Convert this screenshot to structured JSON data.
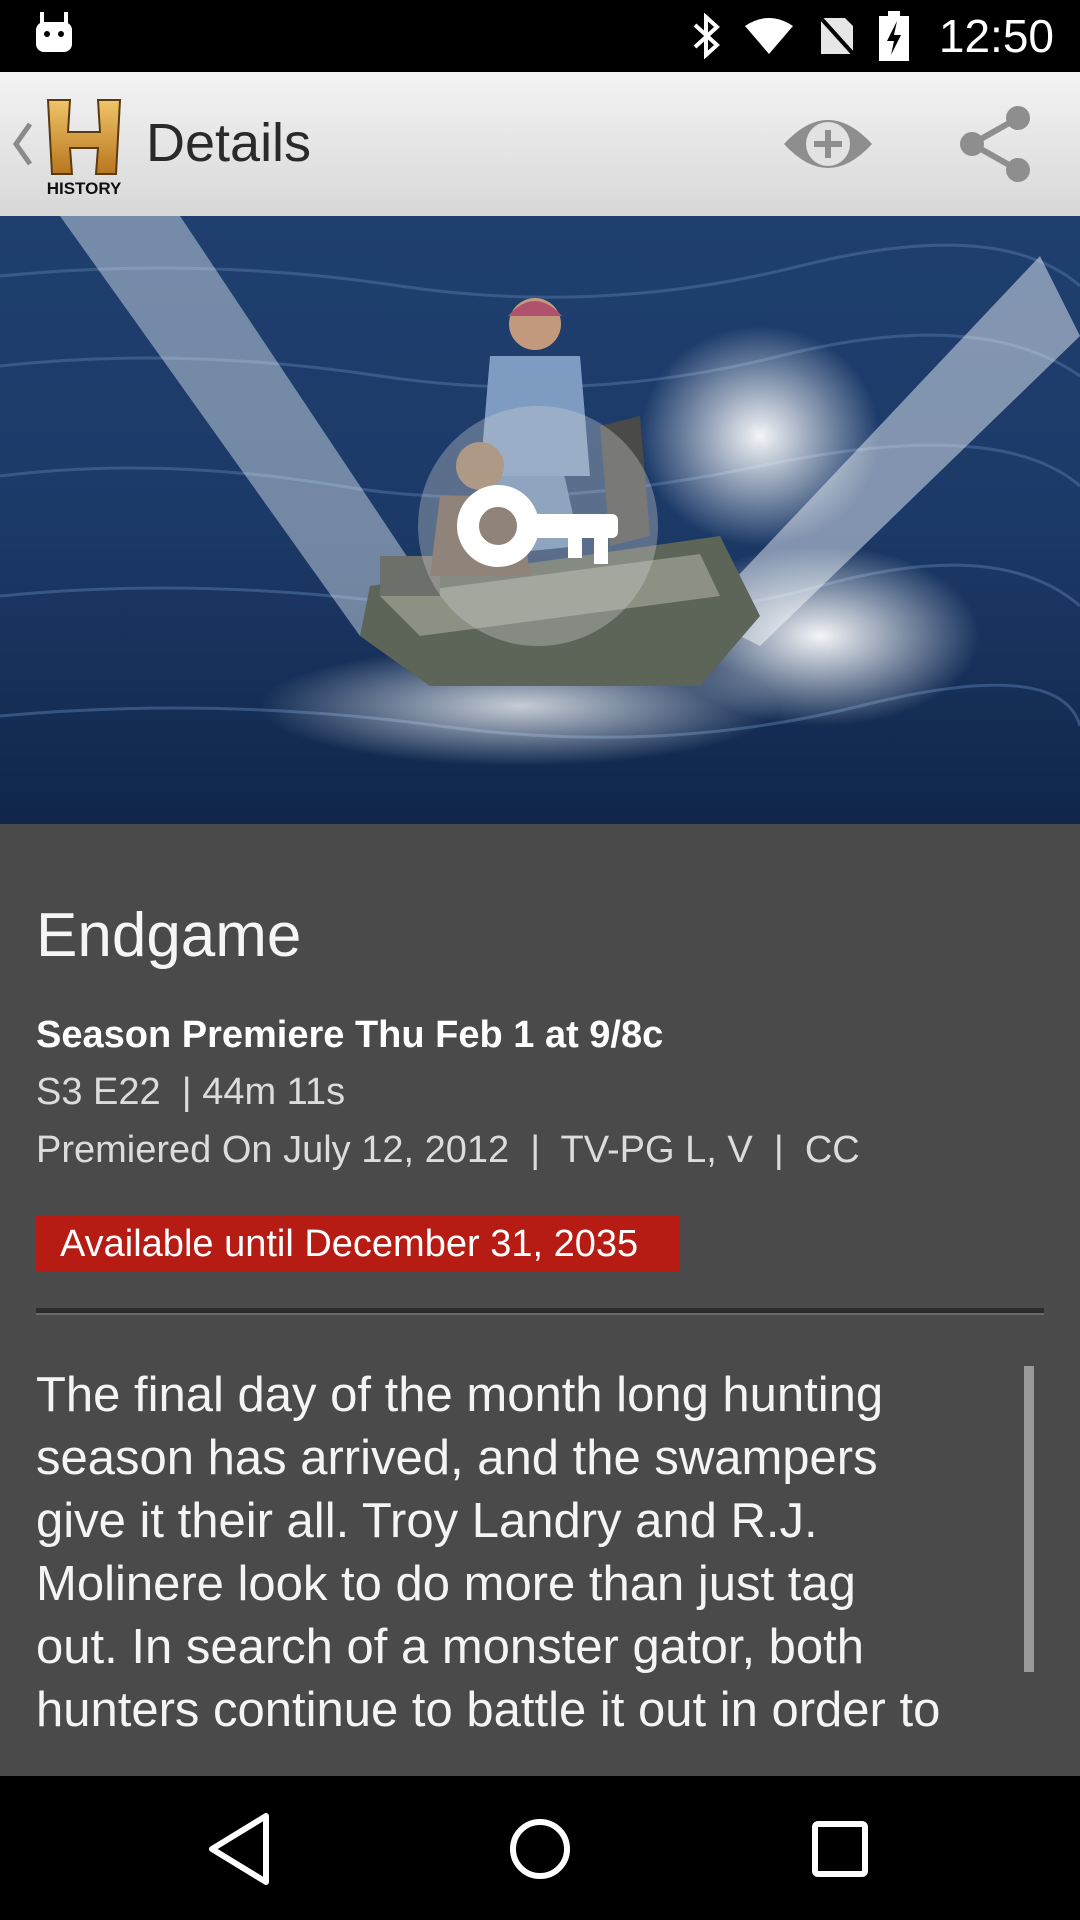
{
  "status_bar": {
    "time": "12:50",
    "icons": [
      "android-debug-icon",
      "bluetooth-icon",
      "wifi-icon",
      "no-sim-icon",
      "battery-charging-icon"
    ]
  },
  "app_bar": {
    "title": "Details",
    "logo_text": "HISTORY",
    "icons": [
      "back-chevron-icon",
      "watchlist-add-icon",
      "share-icon"
    ]
  },
  "hero": {
    "overlay_icon": "key-lock-icon"
  },
  "episode": {
    "title": "Endgame",
    "premiere": "Season Premiere Thu Feb 1 at 9/8c",
    "season_line": "S3 E22  | 44m 11s",
    "meta_line": "Premiered On July 12, 2012  |  TV-PG L, V  |  CC",
    "availability": "Available until December 31, 2035",
    "description_lines": [
      "The final day of the month long hunting",
      "season has arrived, and the swampers",
      "give it their all. Troy Landry and R.J.",
      "Molinere look to do more than just tag",
      "out. In search of a monster gator, both",
      "hunters continue to battle it out in order to"
    ]
  },
  "nav_bar": {
    "buttons": [
      "back-triangle-icon",
      "home-circle-icon",
      "recents-square-icon"
    ]
  },
  "colors": {
    "accent_red": "#b61c13",
    "content_bg": "#4a4a4a",
    "appbar_bg": "#e6e6e6"
  }
}
